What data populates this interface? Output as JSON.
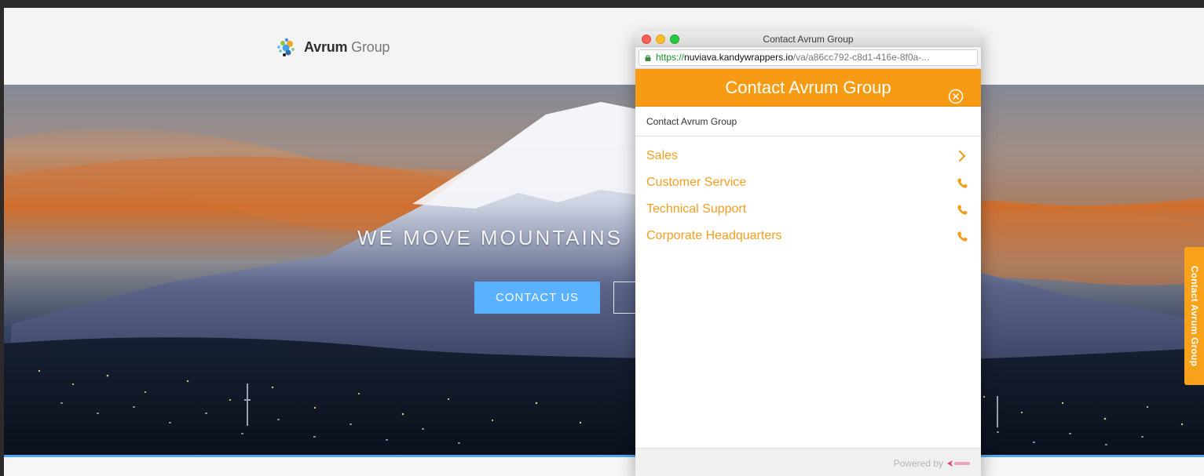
{
  "brand": {
    "name_bold": "Avrum",
    "name_light": "Group"
  },
  "hero": {
    "headline": "WE MOVE MOUNTAINS",
    "contact_button_label": "CONTACT US"
  },
  "side_tab": {
    "label": "Contact Avrum Group"
  },
  "popup": {
    "window_title": "Contact Avrum Group",
    "url": {
      "scheme": "https://",
      "host": "nuviava.kandywrappers.io",
      "path": "/va/a86cc792-c8d1-416e-8f0a-..."
    },
    "header_title": "Contact Avrum Group",
    "subheader": "Contact Avrum Group",
    "items": [
      {
        "label": "Sales",
        "icon": "chevron-right-icon"
      },
      {
        "label": "Customer Service",
        "icon": "phone-icon"
      },
      {
        "label": "Technical Support",
        "icon": "phone-icon"
      },
      {
        "label": "Corporate Headquarters",
        "icon": "phone-icon"
      }
    ],
    "footer": {
      "powered_by": "Powered by"
    }
  },
  "colors": {
    "accent_orange": "#f79b14",
    "accent_blue": "#59b1ff"
  }
}
